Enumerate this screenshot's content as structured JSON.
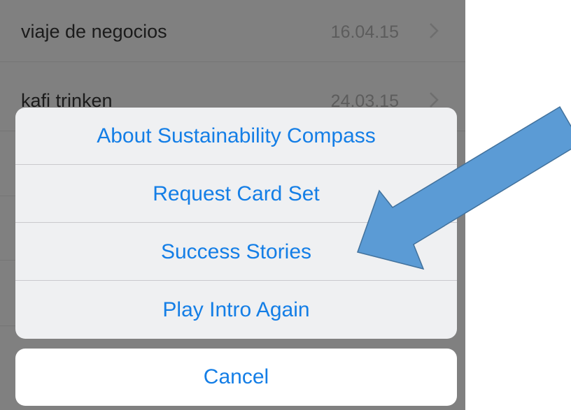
{
  "list": {
    "items": [
      {
        "title": "viaje de negocios",
        "date": "16.04.15"
      },
      {
        "title": "kafi trinken",
        "date": "24.03.15"
      }
    ]
  },
  "action_sheet": {
    "items": [
      {
        "label": "About Sustainability Compass"
      },
      {
        "label": "Request Card Set"
      },
      {
        "label": "Success Stories"
      },
      {
        "label": "Play Intro Again"
      }
    ],
    "cancel_label": "Cancel"
  },
  "colors": {
    "accent": "#147ee6",
    "arrow_fill": "#5b9bd5",
    "arrow_stroke": "#41719c"
  }
}
